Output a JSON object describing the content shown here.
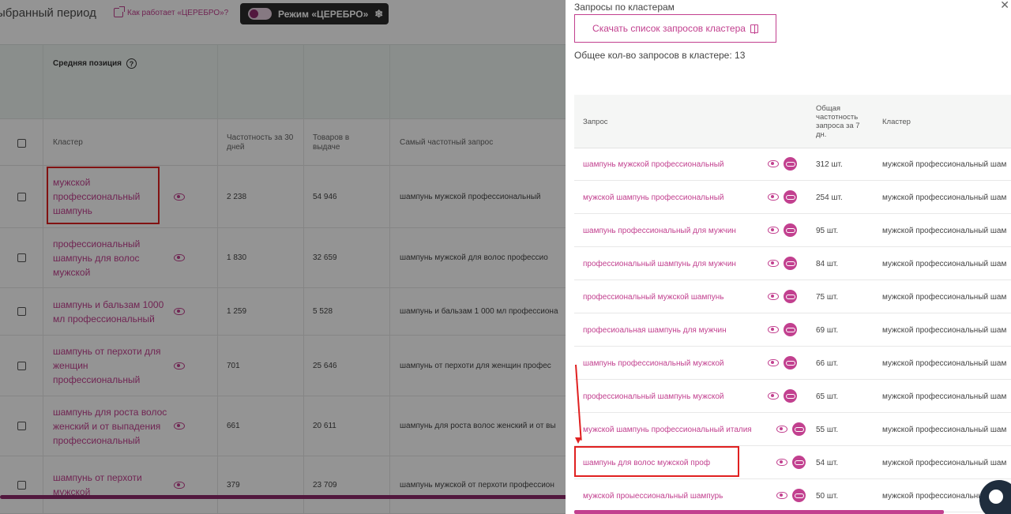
{
  "bg": {
    "period_title": "ыбранный период",
    "how_link": "Как работает «ЦЕРЕБРО»?",
    "mode_button": "Режим «ЦЕРЕБРО»",
    "avg_position": "Средняя позиция",
    "columns": {
      "cluster": "Кластер",
      "freq30": "Частотность за 30 дней",
      "goods": "Товаров в выдаче",
      "top_query": "Самый частотный запрос"
    },
    "rows": [
      {
        "cluster": "мужской профессиональный шампунь",
        "freq": "2 238",
        "goods": "54 946",
        "top": "шампунь мужской профессиональный"
      },
      {
        "cluster": "профессиональный шампунь для волос мужской",
        "freq": "1 830",
        "goods": "32 659",
        "top": "шампунь мужской для волос профессио"
      },
      {
        "cluster": "шампунь и бальзам 1000 мл профессиональный",
        "freq": "1 259",
        "goods": "5 528",
        "top": "шампунь и бальзам 1 000 мл профессиона"
      },
      {
        "cluster": "шампунь от перхоти для женщин профессиональный",
        "freq": "701",
        "goods": "25 646",
        "top": "шампунь от перхоти для женщин профес"
      },
      {
        "cluster": "шампунь для роста волос женский и от выпадения профессиональный",
        "freq": "661",
        "goods": "20 611",
        "top": "шампунь для роста волос женский и от вы"
      },
      {
        "cluster": "шампунь от перхоти мужской",
        "freq": "379",
        "goods": "23 709",
        "top": "шампунь мужской от перхоти профессион"
      }
    ]
  },
  "drawer": {
    "title": "Запросы по кластерам",
    "download_button": "Скачать список запросов кластера",
    "total": "Общее кол-во запросов в кластере: 13",
    "columns": {
      "query": "Запрос",
      "freq7": "Общая частотность запроса за 7 дн.",
      "cluster": "Кластер"
    },
    "rows": [
      {
        "query": "шампунь мужской профессиональный",
        "freq": "312 шт.",
        "cluster": "мужской профессиональный шам"
      },
      {
        "query": "мужской шампунь профессиональный",
        "freq": "254 шт.",
        "cluster": "мужской профессиональный шам"
      },
      {
        "query": "шампунь профессиональный для мужчин",
        "freq": "95 шт.",
        "cluster": "мужской профессиональный шам"
      },
      {
        "query": "профессиональный шампунь для мужчин",
        "freq": "84 шт.",
        "cluster": "мужской профессиональный шам"
      },
      {
        "query": "профессиональный мужской шампунь",
        "freq": "75 шт.",
        "cluster": "мужской профессиональный шам"
      },
      {
        "query": "професиоальная шампунь для мужчин",
        "freq": "69 шт.",
        "cluster": "мужской профессиональный шам"
      },
      {
        "query": "шампунь профессиональный мужской",
        "freq": "66 шт.",
        "cluster": "мужской профессиональный шам"
      },
      {
        "query": "профессиональный шампунь мужской",
        "freq": "65 шт.",
        "cluster": "мужской профессиональный шам"
      },
      {
        "query": "мужской шампунь профессиональный италия",
        "freq": "55 шт.",
        "cluster": "мужской профессиональный шам"
      },
      {
        "query": "шампунь для волос мужской проф",
        "freq": "54 шт.",
        "cluster": "мужской профессиональный шам"
      },
      {
        "query": "мужской проыессиональный шампурь",
        "freq": "50 шт.",
        "cluster": "мужской профессиональный шам"
      }
    ]
  },
  "colors": {
    "accent": "#c2408f",
    "dark": "#2c2c2c",
    "highlight": "#e02020"
  }
}
